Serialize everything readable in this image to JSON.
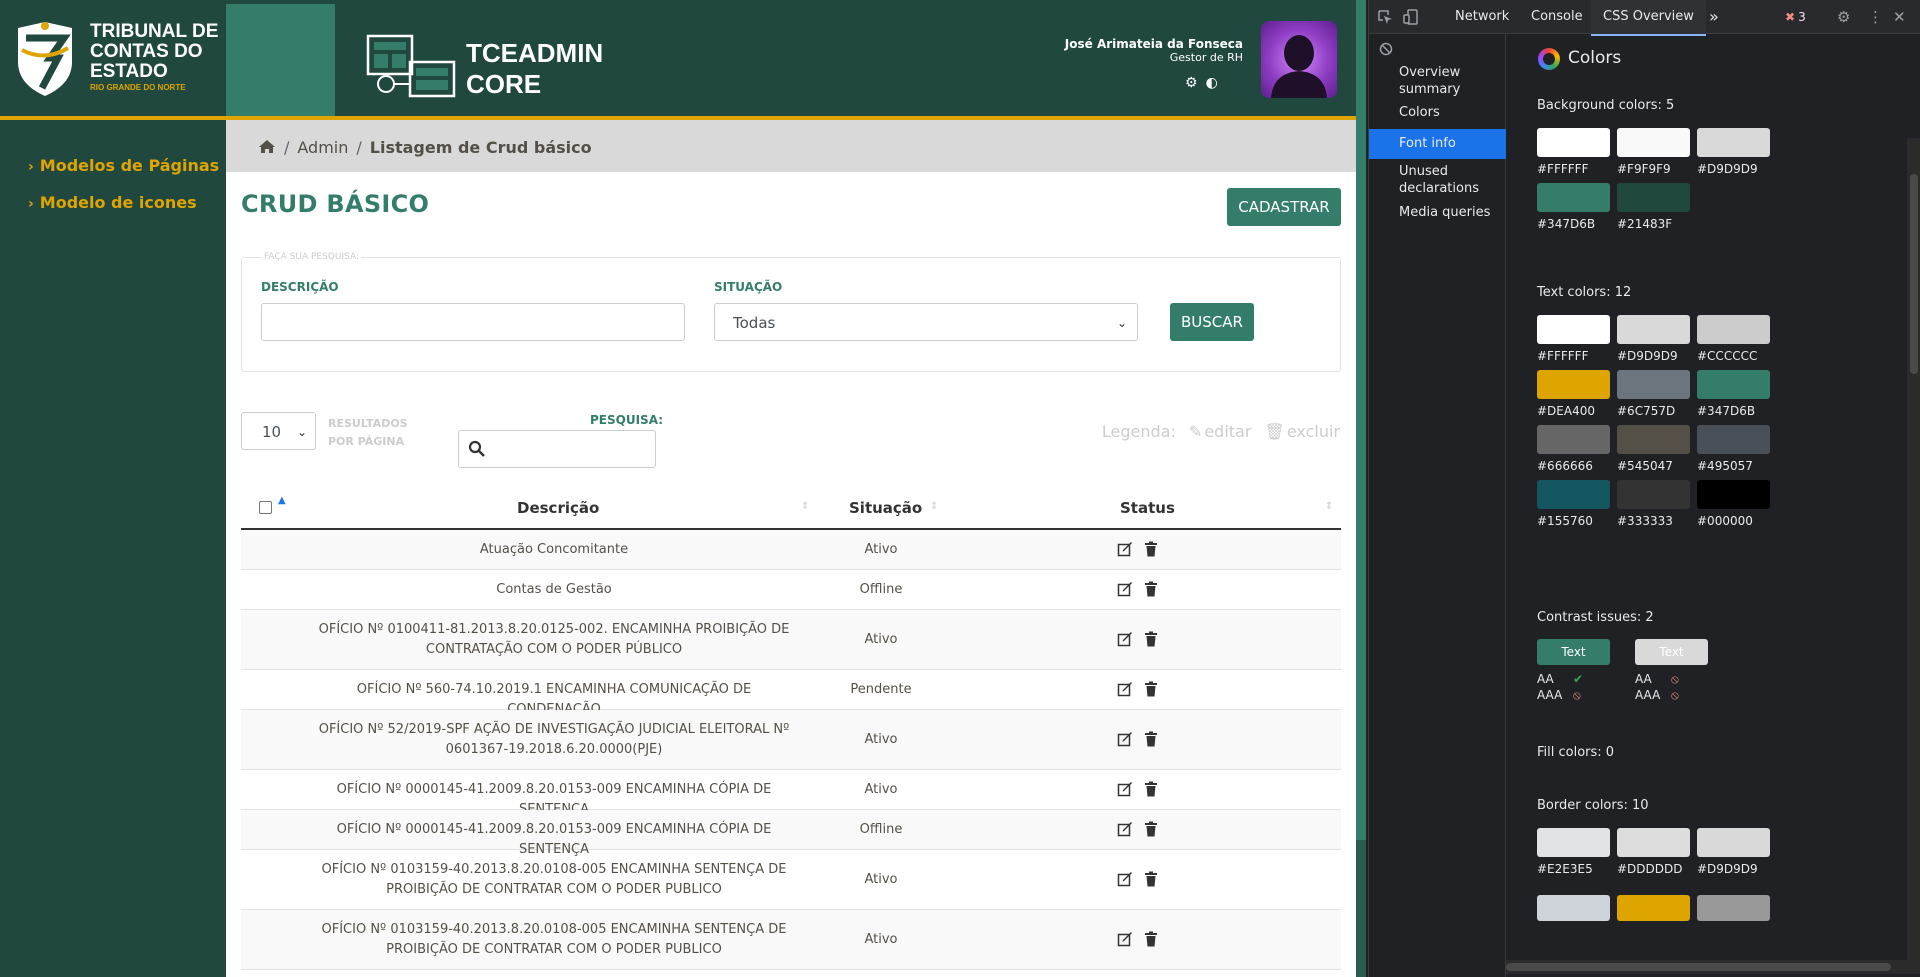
{
  "header": {
    "logo_line1": "TRIBUNAL DE",
    "logo_line2": "CONTAS DO",
    "logo_line3": "ESTADO",
    "logo_sub": "RIO GRANDE DO NORTE",
    "app_name_line1": "TCEADMIN",
    "app_name_line2": "CORE",
    "user_name": "José Arimateia da Fonseca",
    "user_role": "Gestor de RH",
    "settings_icon": "gear-icon",
    "theme_icon": "contrast-icon"
  },
  "sidebar": {
    "items": [
      {
        "label": "Modelos de Páginas"
      },
      {
        "label": "Modelo de icones"
      }
    ]
  },
  "breadcrumb": {
    "home_icon": "home-icon",
    "items": [
      "Admin",
      "Listagem de Crud básico"
    ]
  },
  "page": {
    "title": "CRUD BÁSICO",
    "cadastrar_label": "CADASTRAR"
  },
  "search": {
    "legend": "FAÇA SUA PESQUISA:",
    "desc_label": "DESCRIÇÃO",
    "desc_value": "",
    "sit_label": "SITUAÇÃO",
    "sit_value": "Todas",
    "buscar_label": "BUSCAR"
  },
  "listing": {
    "page_size": "10",
    "page_size_label": "RESULTADOS POR PÁGINA",
    "pesquisa_label": "PESQUISA:",
    "legend_label": "Legenda:",
    "legend_edit": "editar",
    "legend_delete": "excluir"
  },
  "table": {
    "headers": [
      "Descrição",
      "Situação",
      "Status"
    ],
    "rows": [
      {
        "desc": "Atuação Concomitante",
        "sit": "Ativo"
      },
      {
        "desc": "Contas de Gestão",
        "sit": "Offline"
      },
      {
        "desc": "OFÍCIO Nº 0100411-81.2013.8.20.0125-002. ENCAMINHA PROIBIÇÃO DE CONTRATAÇÃO COM O PODER PÚBLICO",
        "sit": "Ativo"
      },
      {
        "desc": "OFÍCIO Nº 560-74.10.2019.1 ENCAMINHA COMUNICAÇÃO DE CONDENAÇÃO",
        "sit": "Pendente"
      },
      {
        "desc": "OFÍCIO Nº 52/2019-SPF AÇÃO DE INVESTIGAÇÃO JUDICIAL ELEITORAL Nº 0601367-19.2018.6.20.0000(PJE)",
        "sit": "Ativo"
      },
      {
        "desc": "OFÍCIO Nº 0000145-41.2009.8.20.0153-009 ENCAMINHA CÓPIA DE SENTENÇA",
        "sit": "Ativo"
      },
      {
        "desc": "OFÍCIO Nº 0000145-41.2009.8.20.0153-009 ENCAMINHA CÓPIA DE SENTENÇA",
        "sit": "Offline"
      },
      {
        "desc": "OFÍCIO Nº 0103159-40.2013.8.20.0108-005 ENCAMINHA SENTENÇA DE PROIBIÇÃO DE CONTRATAR COM O PODER PUBLICO",
        "sit": "Ativo"
      },
      {
        "desc": "OFÍCIO Nº 0103159-40.2013.8.20.0108-005 ENCAMINHA SENTENÇA DE PROIBIÇÃO DE CONTRATAR COM O PODER PUBLICO",
        "sit": "Ativo"
      }
    ]
  },
  "devtools": {
    "tabs": [
      "Network",
      "Console",
      "CSS Overview"
    ],
    "active_tab": "CSS Overview",
    "error_count": "3",
    "nav": [
      "Overview summary",
      "Colors",
      "Font info",
      "Unused declarations",
      "Media queries"
    ],
    "active_nav": "Font info",
    "title": "Colors",
    "background_title": "Background colors: 5",
    "background_colors": [
      "#FFFFFF",
      "#F9F9F9",
      "#D9D9D9",
      "#347D6B",
      "#21483F"
    ],
    "text_title": "Text colors: 12",
    "text_colors": [
      "#FFFFFF",
      "#D9D9D9",
      "#CCCCCC",
      "#DEA400",
      "#6C757D",
      "#347D6B",
      "#666666",
      "#545047",
      "#495057",
      "#155760",
      "#333333",
      "#000000"
    ],
    "contrast_title": "Contrast issues: 2",
    "contrast_chip_label": "Text",
    "aa_label": "AA",
    "aaa_label": "AAA",
    "fill_title": "Fill colors: 0",
    "border_title": "Border colors: 10",
    "border_colors": [
      "#E2E3E5",
      "#DDDDDD",
      "#D9D9D9"
    ],
    "border_extra_colors": [
      "#CED4DA",
      "#DEA400",
      "#999999"
    ]
  },
  "colors": {
    "primary": "#347D6B",
    "dark": "#21483F",
    "accent": "#DEA400"
  }
}
